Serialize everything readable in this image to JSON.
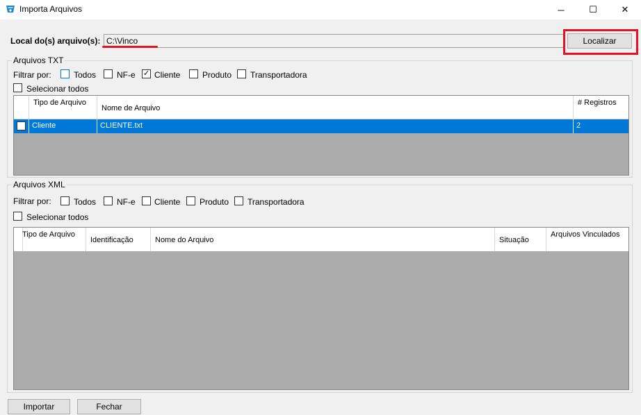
{
  "window": {
    "title": "Importa Arquivos",
    "icon": "app-icon",
    "controls": {
      "minimize": "─",
      "maximize": "☐",
      "close": "✕"
    }
  },
  "path": {
    "label": "Local do(s) arquivo(s):",
    "value": "C:\\Vinco",
    "button_label": "Localizar",
    "highlight_color": "#e81123"
  },
  "txt_group": {
    "title": "Arquivos TXT",
    "filter_label": "Filtrar por:",
    "filters": [
      {
        "label": "Todos",
        "checked": false
      },
      {
        "label": "NF-e",
        "checked": false
      },
      {
        "label": "Cliente",
        "checked": true
      },
      {
        "label": "Produto",
        "checked": false
      },
      {
        "label": "Transportadora",
        "checked": false
      }
    ],
    "select_all_label": "Selecionar todos",
    "columns": [
      "Tipo de Arquivo",
      "Nome de Arquivo",
      "# Registros"
    ],
    "rows": [
      {
        "checked": false,
        "tipo": "Cliente",
        "nome": "CLIENTE.txt",
        "registros": "2"
      }
    ]
  },
  "xml_group": {
    "title": "Arquivos XML",
    "filter_label": "Filtrar por:",
    "filters": [
      {
        "label": "Todos",
        "checked": false
      },
      {
        "label": "NF-e",
        "checked": false
      },
      {
        "label": "Cliente",
        "checked": false
      },
      {
        "label": "Produto",
        "checked": false
      },
      {
        "label": "Transportadora",
        "checked": false
      }
    ],
    "select_all_label": "Selecionar todos",
    "columns": [
      "Tipo de Arquivo",
      "Identificação",
      "Nome do Arquivo",
      "Situação",
      "Arquivos Vinculados"
    ],
    "rows": []
  },
  "buttons": {
    "importar": "Importar",
    "fechar": "Fechar"
  },
  "colors": {
    "selection": "#0078d7",
    "grid_empty": "#ababab"
  }
}
